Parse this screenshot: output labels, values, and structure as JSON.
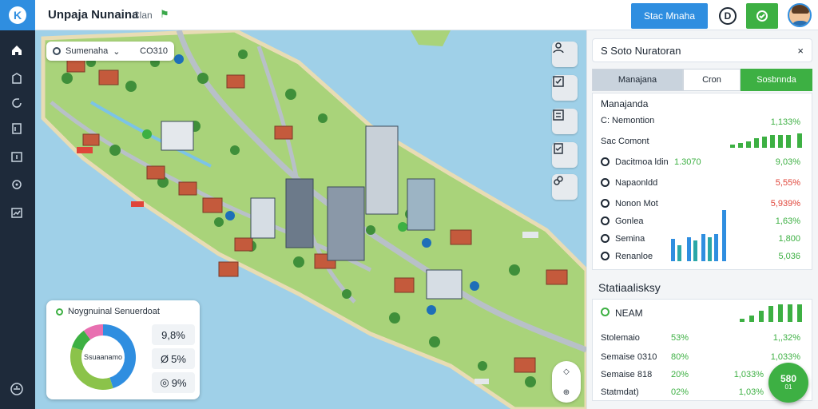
{
  "app": {
    "title": "Unpaja Nunaina",
    "subtitle": "Clan",
    "logo": "K"
  },
  "topbar": {
    "primary_button": "Stac Mnaha",
    "circle_button": "D",
    "green_button_icon": "location-icon"
  },
  "sidebar": {
    "items": [
      {
        "icon": "home-icon"
      },
      {
        "icon": "building-icon"
      },
      {
        "icon": "refresh-icon"
      },
      {
        "icon": "document-icon"
      },
      {
        "icon": "calendar-icon"
      },
      {
        "icon": "network-icon"
      },
      {
        "icon": "chart-icon"
      },
      {
        "icon": "settings-icon"
      }
    ]
  },
  "map": {
    "search": {
      "label": "Sumenaha",
      "code": "CO310"
    },
    "tools": [
      "person-icon",
      "check-icon",
      "list-icon",
      "clipboard-icon",
      "link-icon"
    ],
    "compass": {
      "top": "◇",
      "bottom": "⊕"
    }
  },
  "donut": {
    "title": "Noygnuinal Senuerdoat",
    "center": "Ssuaanamo",
    "values": [
      {
        "text": "9,8%",
        "icon": ""
      },
      {
        "text": "5%",
        "icon": "Ø"
      },
      {
        "text": "9%",
        "icon": "◎"
      }
    ],
    "segments": [
      {
        "value": 45,
        "color": "#2f8ee0"
      },
      {
        "value": 35,
        "color": "#8bc34a"
      },
      {
        "value": 10,
        "color": "#3db043"
      },
      {
        "value": 10,
        "color": "#e86fb0"
      }
    ]
  },
  "panel": {
    "header": "S Soto Nuratoran",
    "close": "×",
    "tabs": [
      "Manajana",
      "Cron",
      "Sosbnnda"
    ],
    "section1_title": "Manajanda",
    "row_summary": {
      "label": "C: Nemontion",
      "value": "1,133%"
    },
    "row_bars_label": "Sac Comont",
    "rows": [
      {
        "label": "Dacitmoa ldin",
        "mid": "1.3070",
        "value": "9,03%",
        "red": false
      },
      {
        "label": "Napaonldd",
        "mid": "",
        "value": "5,55%",
        "red": true
      },
      {
        "label": "Nonon Mot",
        "mid": "",
        "value": "5,939%",
        "red": true
      },
      {
        "label": "Gonlea",
        "mid": "",
        "value": "1,63%",
        "red": false
      },
      {
        "label": "Semina",
        "mid": "",
        "value": "1,800",
        "red": false
      },
      {
        "label": "Renanloe",
        "mid": "",
        "value": "5,036",
        "red": false
      }
    ],
    "section2_title": "Statiaalisksy",
    "section2_head": "NEAM",
    "rows2": [
      {
        "label": "Stolemaio",
        "mid": "53%",
        "value": "1,,32%"
      },
      {
        "label": "Semaise 0310",
        "mid": "80%",
        "value": "1,033%"
      },
      {
        "label": "Semaise 818",
        "mid": "20%",
        "value": "1,033%"
      },
      {
        "label": "Statmdat)",
        "mid": "02%",
        "value": "1,03%"
      }
    ]
  },
  "fab": {
    "main": "580",
    "sub": "01"
  },
  "colors": {
    "accent": "#2f8ee0",
    "green": "#3db043",
    "red": "#e0453a"
  }
}
